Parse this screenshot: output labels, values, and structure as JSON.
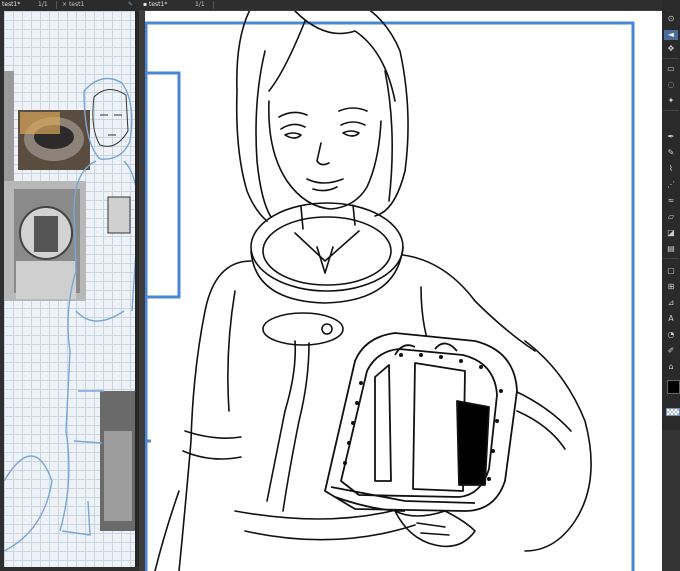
{
  "left_document": {
    "tab": {
      "title": "test1*",
      "pages": "1/1",
      "closed_title": "test1"
    }
  },
  "main_document": {
    "tab": {
      "title": "test1*",
      "pages": "1/1"
    }
  },
  "colors": {
    "frame_border": "#4a86d6",
    "sketch_blue": "#7aa6d8",
    "ink": "#111111",
    "ui_dark": "#2f2f2f"
  },
  "tool_panel": {
    "icons": [
      "dropper-icon",
      "operation-icon",
      "pen-icon",
      "pencil-icon",
      "brush-icon",
      "airbrush-icon",
      "blend-icon",
      "eraser-icon",
      "fill-icon",
      "gradient-icon",
      "figure-icon",
      "frame-icon",
      "ruler-icon",
      "text-icon",
      "balloon-icon",
      "correction-icon",
      "fill-bucket-icon"
    ],
    "main_color": "#000000"
  }
}
